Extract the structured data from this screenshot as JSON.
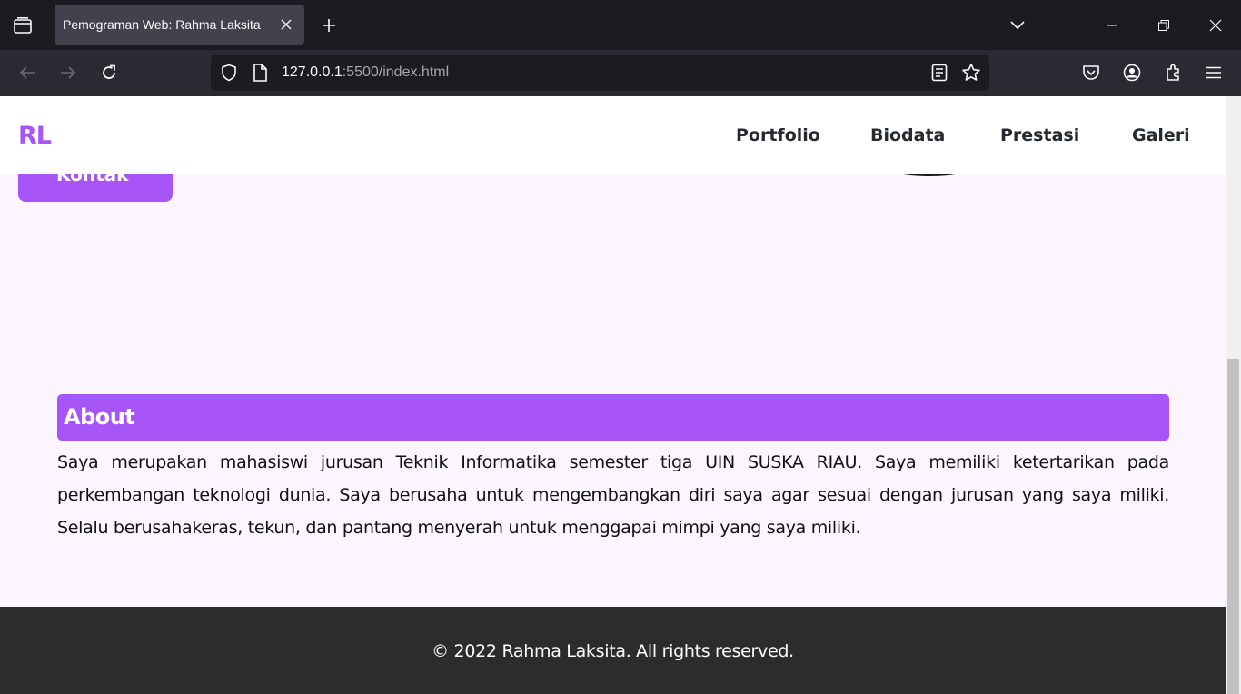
{
  "browser": {
    "tab_title": "Pemograman Web: Rahma Laksita",
    "url_host": "127.0.0.1",
    "url_rest": ":5500/index.html"
  },
  "site": {
    "logo": "RL",
    "menu": [
      {
        "label": "Portfolio"
      },
      {
        "label": "Biodata"
      },
      {
        "label": "Prestasi"
      },
      {
        "label": "Galeri"
      }
    ],
    "cta_label": "Kontak",
    "about": {
      "heading": "About",
      "text": "Saya merupakan mahasiswi jurusan Teknik Informatika semester tiga UIN SUSKA RIAU. Saya memiliki ketertarikan pada perkembangan teknologi dunia. Saya berusaha untuk mengembangkan diri saya agar sesuai dengan jurusan yang saya miliki. Selalu berusahakeras, tekun, dan pantang menyerah untuk menggapai mimpi yang saya miliki."
    },
    "footer": "© 2022 Rahma Laksita. All rights reserved."
  },
  "colors": {
    "accent": "#a855f7",
    "page_bg": "#faf5fe",
    "footer_bg": "#2c2c2c"
  },
  "icons": [
    "tab-list-icon",
    "close-icon",
    "plus-icon",
    "chevron-down-icon",
    "minimize-icon",
    "restore-icon",
    "back-icon",
    "forward-icon",
    "reload-icon",
    "shield-icon",
    "page-icon",
    "reader-view-icon",
    "star-icon",
    "pocket-icon",
    "account-icon",
    "extensions-icon",
    "menu-icon"
  ]
}
